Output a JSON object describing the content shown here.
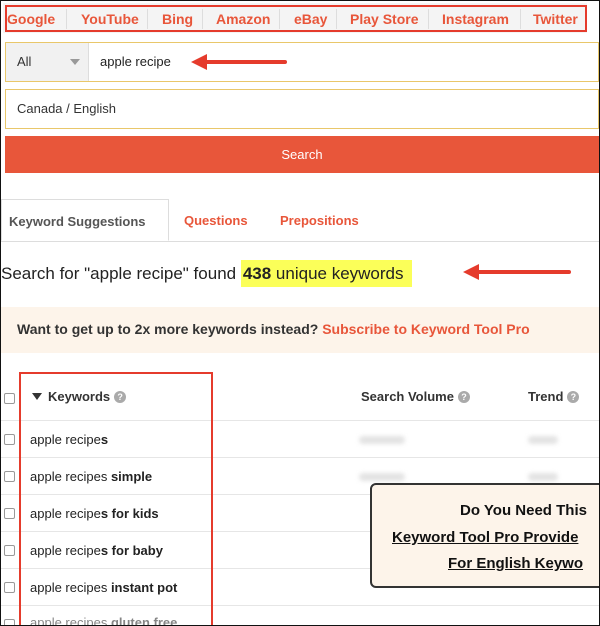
{
  "engines": [
    "Google",
    "YouTube",
    "Bing",
    "Amazon",
    "eBay",
    "Play Store",
    "Instagram",
    "Twitter"
  ],
  "search": {
    "type_value": "All",
    "query": "apple recipe",
    "location_language": "Canada / English",
    "button_label": "Search"
  },
  "result_tabs": {
    "suggestions": "Keyword Suggestions",
    "questions": "Questions",
    "prepositions": "Prepositions"
  },
  "found": {
    "prefix": "Search for \"apple recipe\" found ",
    "count": "438",
    "suffix": " unique keywords"
  },
  "promo": {
    "text": "Want to get up to 2x more keywords instead? ",
    "link": "Subscribe to Keyword Tool Pro"
  },
  "table": {
    "col_keywords": "Keywords",
    "col_volume": "Search Volume",
    "col_trend": "Trend",
    "help_glyph": "?",
    "rows": [
      {
        "base": "apple recipe",
        "suffix": "s"
      },
      {
        "base": "apple recipes",
        "suffix": " simple"
      },
      {
        "base": "apple recipe",
        "suffix": "s for kids"
      },
      {
        "base": "apple recipe",
        "suffix": "s for baby"
      },
      {
        "base": "apple recipes",
        "suffix": " instant pot"
      },
      {
        "base": "apple recipes",
        "suffix": " gluten free"
      }
    ]
  },
  "popup": {
    "line1": "Do You Need This",
    "line2": "Keyword Tool Pro Provide",
    "line3": "For English Keywo"
  },
  "colors": {
    "accent": "#e8563a",
    "annotation_red": "#e53b2c",
    "highlight": "#fbff59",
    "promo_bg": "#fdf4ea"
  }
}
